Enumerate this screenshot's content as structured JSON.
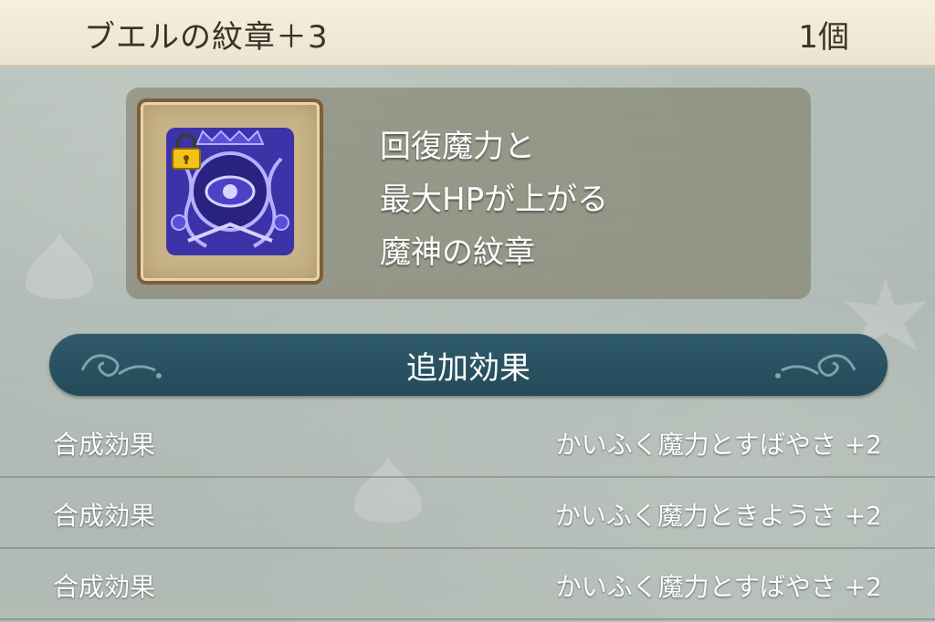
{
  "header": {
    "item_name": "ブエルの紋章＋3",
    "count": "1個"
  },
  "item": {
    "icon": "buer-crest-emblem-icon",
    "locked": true,
    "description": "回復魔力と\n最大HPが上がる\n魔神の紋章"
  },
  "section": {
    "title": "追加効果"
  },
  "effects": [
    {
      "label": "合成効果",
      "value": "かいふく魔力とすばやさ +2"
    },
    {
      "label": "合成効果",
      "value": "かいふく魔力ときようさ +2"
    },
    {
      "label": "合成効果",
      "value": "かいふく魔力とすばやさ +2"
    }
  ],
  "colors": {
    "header_bg": "#f5efdf",
    "section_bar": "#2f5a6b",
    "emblem": "#5a4fd6",
    "frame": "#7e5e3a"
  }
}
